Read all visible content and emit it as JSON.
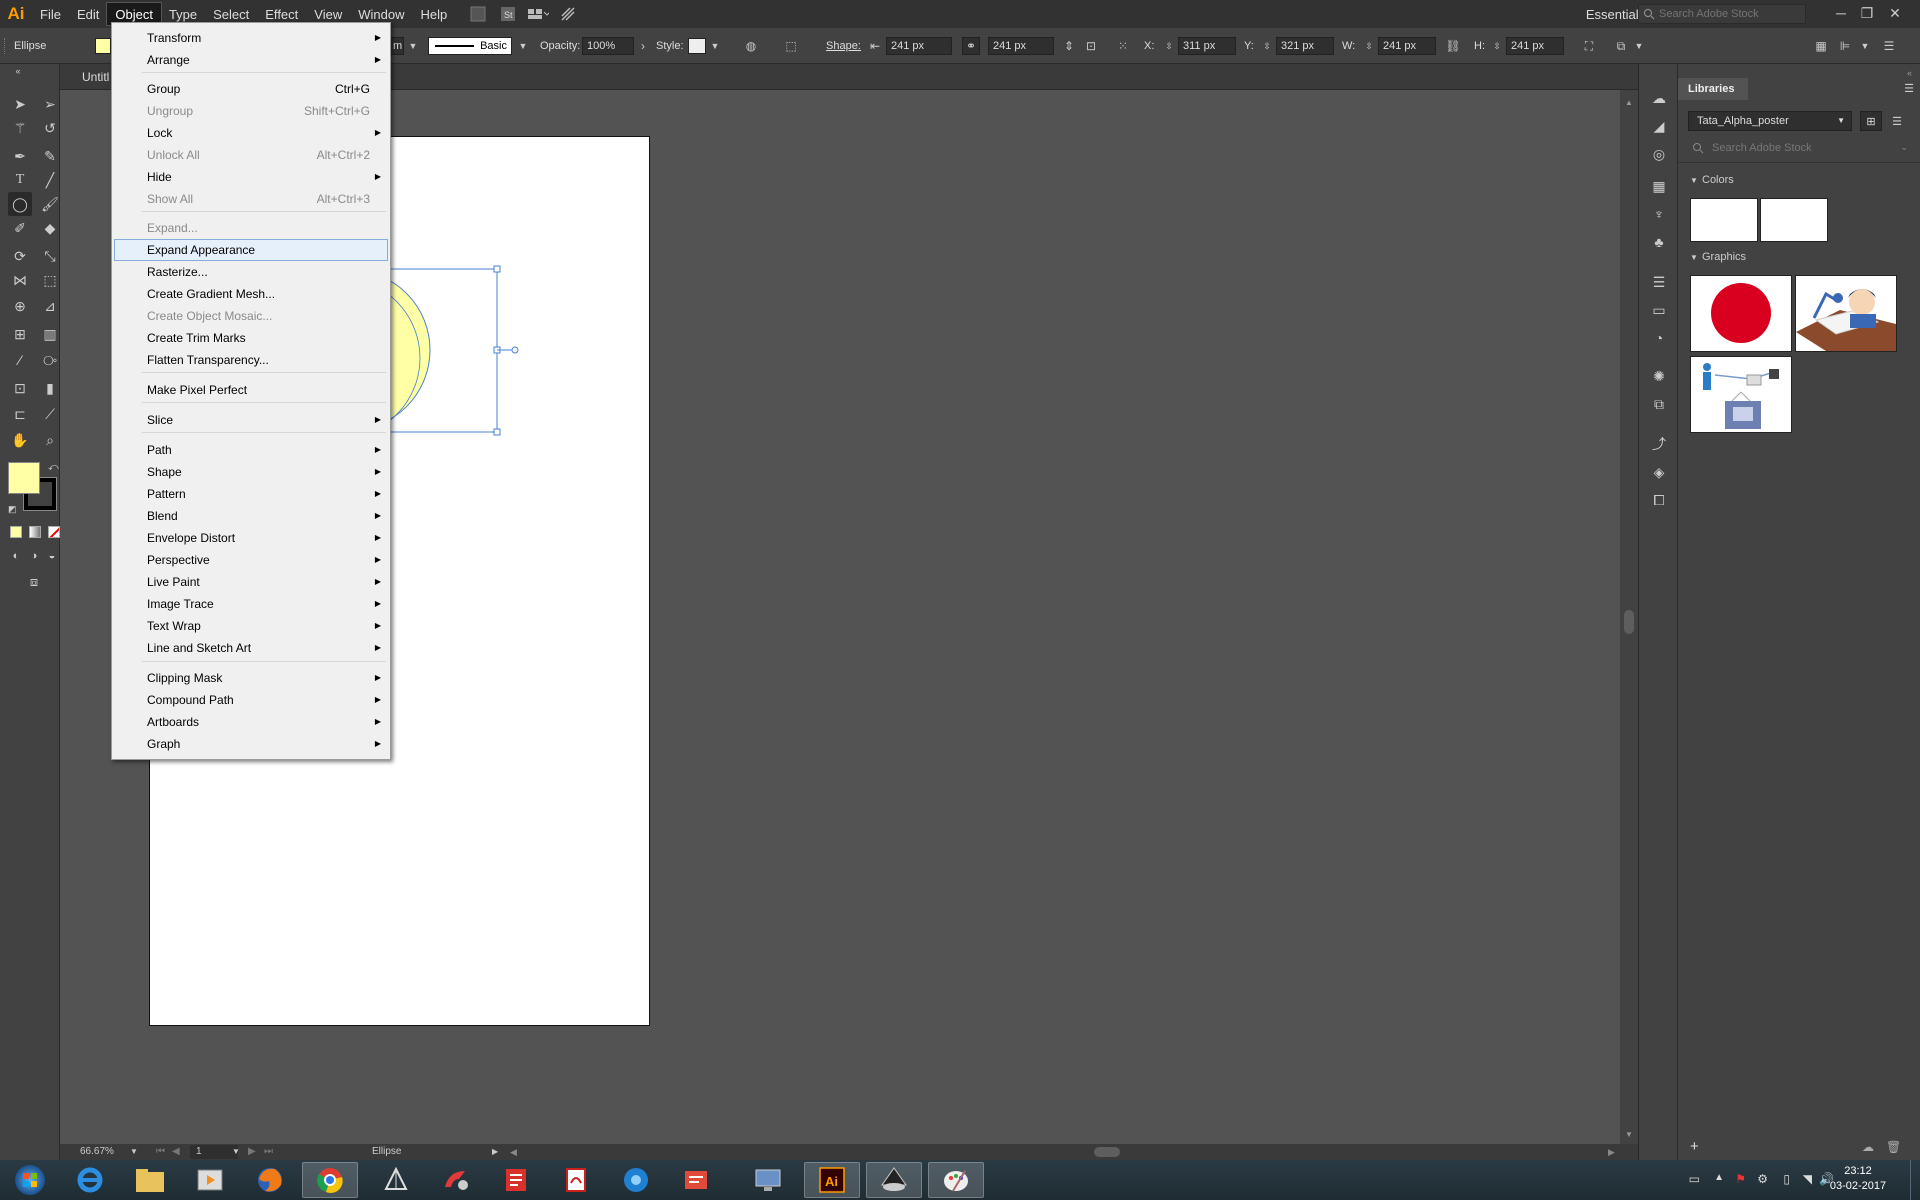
{
  "menubar": {
    "logo": "Ai",
    "items": [
      "File",
      "Edit",
      "Object",
      "Type",
      "Select",
      "Effect",
      "View",
      "Window",
      "Help"
    ],
    "active_item": "Object",
    "workspace": "Essentials",
    "stock_search_placeholder": "Search Adobe Stock"
  },
  "controlbar": {
    "selection_type": "Ellipse",
    "stroke_style": "Basic",
    "opacity_label": "Opacity:",
    "opacity_value": "100%",
    "style_label": "Style:",
    "shape_label": "Shape:",
    "shape_w": "241 px",
    "shape_h": "241 px",
    "x_label": "X:",
    "x_value": "311 px",
    "y_label": "Y:",
    "y_value": "321 px",
    "w_label": "W:",
    "w_value": "241 px",
    "h_label": "H:",
    "h_value": "241 px",
    "partial_unit": "m"
  },
  "document": {
    "tab_title": "Untitl",
    "zoom": "66.67%",
    "artboard_number": "1",
    "status_text": "Ellipse"
  },
  "colors": {
    "fill": "#ffffa6",
    "stroke": "#000000",
    "selection": "#4a7fd4",
    "menu_highlight_border": "#84acdd"
  },
  "object_menu": {
    "items": [
      {
        "label": "Transform",
        "shortcut": "",
        "submenu": true,
        "disabled": false
      },
      {
        "label": "Arrange",
        "shortcut": "",
        "submenu": true,
        "disabled": false
      },
      {
        "label": "Group",
        "shortcut": "Ctrl+G",
        "submenu": false,
        "disabled": false
      },
      {
        "label": "Ungroup",
        "shortcut": "Shift+Ctrl+G",
        "submenu": false,
        "disabled": true
      },
      {
        "label": "Lock",
        "shortcut": "",
        "submenu": true,
        "disabled": false
      },
      {
        "label": "Unlock All",
        "shortcut": "Alt+Ctrl+2",
        "submenu": false,
        "disabled": true
      },
      {
        "label": "Hide",
        "shortcut": "",
        "submenu": true,
        "disabled": false
      },
      {
        "label": "Show All",
        "shortcut": "Alt+Ctrl+3",
        "submenu": false,
        "disabled": true
      },
      {
        "label": "Expand...",
        "shortcut": "",
        "submenu": false,
        "disabled": true
      },
      {
        "label": "Expand Appearance",
        "shortcut": "",
        "submenu": false,
        "disabled": false,
        "highlighted": true
      },
      {
        "label": "Rasterize...",
        "shortcut": "",
        "submenu": false,
        "disabled": false
      },
      {
        "label": "Create Gradient Mesh...",
        "shortcut": "",
        "submenu": false,
        "disabled": false
      },
      {
        "label": "Create Object Mosaic...",
        "shortcut": "",
        "submenu": false,
        "disabled": true
      },
      {
        "label": "Create Trim Marks",
        "shortcut": "",
        "submenu": false,
        "disabled": false
      },
      {
        "label": "Flatten Transparency...",
        "shortcut": "",
        "submenu": false,
        "disabled": false
      },
      {
        "label": "Make Pixel Perfect",
        "shortcut": "",
        "submenu": false,
        "disabled": false
      },
      {
        "label": "Slice",
        "shortcut": "",
        "submenu": true,
        "disabled": false
      },
      {
        "label": "Path",
        "shortcut": "",
        "submenu": true,
        "disabled": false
      },
      {
        "label": "Shape",
        "shortcut": "",
        "submenu": true,
        "disabled": false
      },
      {
        "label": "Pattern",
        "shortcut": "",
        "submenu": true,
        "disabled": false
      },
      {
        "label": "Blend",
        "shortcut": "",
        "submenu": true,
        "disabled": false
      },
      {
        "label": "Envelope Distort",
        "shortcut": "",
        "submenu": true,
        "disabled": false
      },
      {
        "label": "Perspective",
        "shortcut": "",
        "submenu": true,
        "disabled": false
      },
      {
        "label": "Live Paint",
        "shortcut": "",
        "submenu": true,
        "disabled": false
      },
      {
        "label": "Image Trace",
        "shortcut": "",
        "submenu": true,
        "disabled": false
      },
      {
        "label": "Text Wrap",
        "shortcut": "",
        "submenu": true,
        "disabled": false
      },
      {
        "label": "Line and Sketch Art",
        "shortcut": "",
        "submenu": true,
        "disabled": false
      },
      {
        "label": "Clipping Mask",
        "shortcut": "",
        "submenu": true,
        "disabled": false
      },
      {
        "label": "Compound Path",
        "shortcut": "",
        "submenu": true,
        "disabled": false
      },
      {
        "label": "Artboards",
        "shortcut": "",
        "submenu": true,
        "disabled": false
      },
      {
        "label": "Graph",
        "shortcut": "",
        "submenu": true,
        "disabled": false
      }
    ]
  },
  "libraries": {
    "tab_label": "Libraries",
    "selected_library": "Tata_Alpha_poster",
    "search_placeholder": "Search Adobe Stock",
    "colors_heading": "Colors",
    "graphics_heading": "Graphics"
  },
  "taskbar": {
    "time": "23:12",
    "date": "03-02-2017"
  }
}
